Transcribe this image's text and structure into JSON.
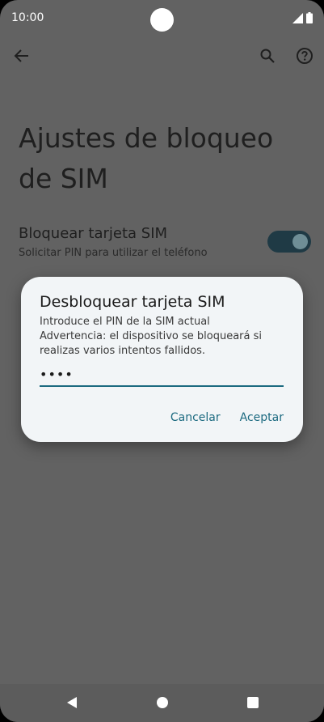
{
  "status_bar": {
    "time": "10:00",
    "icons": [
      "signal-icon",
      "battery-icon"
    ]
  },
  "app_bar": {
    "back_icon": "arrow-back-icon",
    "search_icon": "search-icon",
    "help_icon": "help-icon"
  },
  "page": {
    "title_line1": "Ajustes de bloqueo",
    "title_line2": "de SIM"
  },
  "setting": {
    "title": "Bloquear tarjeta SIM",
    "subtitle": "Solicitar PIN para utilizar el teléfono",
    "toggle_on": true
  },
  "dialog": {
    "title": "Desbloquear tarjeta SIM",
    "message_line1": "Introduce el PIN de la SIM actual",
    "message_line2": "Advertencia: el dispositivo se bloqueará si",
    "message_line3": "realizas varios intentos fallidos.",
    "pin_value": "••••",
    "cancel_label": "Cancelar",
    "accept_label": "Aceptar"
  },
  "colors": {
    "scrim": "#626262",
    "dialog_bg": "#f2f5f7",
    "accent": "#1c6a80",
    "toggle_track": "#1f3a45"
  },
  "nav_bar": {
    "icons": [
      "nav-back-icon",
      "nav-home-icon",
      "nav-recents-icon"
    ]
  }
}
